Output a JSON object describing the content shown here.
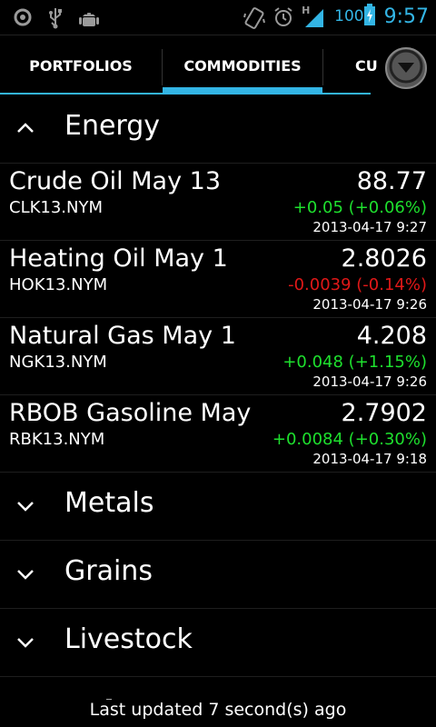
{
  "status_bar": {
    "left_icons": [
      "circle-icon",
      "usb-icon",
      "android-debug-icon"
    ],
    "right_icons": [
      "vibrate-icon",
      "alarm-icon",
      "signal-icon",
      "battery-icon"
    ],
    "network_type": "H",
    "battery_percent": "100",
    "time": "9:57",
    "accent_color": "#33b5e5"
  },
  "tabs": {
    "items": [
      {
        "label": "PORTFOLIOS",
        "active": false
      },
      {
        "label": "COMMODITIES",
        "active": true
      },
      {
        "label": "CU",
        "active": false
      }
    ],
    "menu_icon": "dropdown-circle-icon"
  },
  "groups": [
    {
      "title": "Energy",
      "expanded": true,
      "rows": [
        {
          "name": "Crude Oil May 13",
          "symbol": "CLK13.NYM",
          "price": "88.77",
          "change": "+0.05 (+0.06%)",
          "direction": "up",
          "timestamp": "2013-04-17 9:27"
        },
        {
          "name": "Heating Oil May 1",
          "symbol": "HOK13.NYM",
          "price": "2.8026",
          "change": "-0.0039 (-0.14%)",
          "direction": "down",
          "timestamp": "2013-04-17 9:26"
        },
        {
          "name": "Natural Gas May 1",
          "symbol": "NGK13.NYM",
          "price": "4.208",
          "change": "+0.048 (+1.15%)",
          "direction": "up",
          "timestamp": "2013-04-17 9:26"
        },
        {
          "name": "RBOB Gasoline May",
          "symbol": "RBK13.NYM",
          "price": "2.7902",
          "change": "+0.0084 (+0.30%)",
          "direction": "up",
          "timestamp": "2013-04-17 9:18"
        }
      ]
    },
    {
      "title": "Metals",
      "expanded": false
    },
    {
      "title": "Grains",
      "expanded": false
    },
    {
      "title": "Livestock",
      "expanded": false
    }
  ],
  "footer": {
    "text": "Last updated 7 second(s) ago"
  },
  "colors": {
    "up": "#1ee02e",
    "down": "#e01818"
  }
}
